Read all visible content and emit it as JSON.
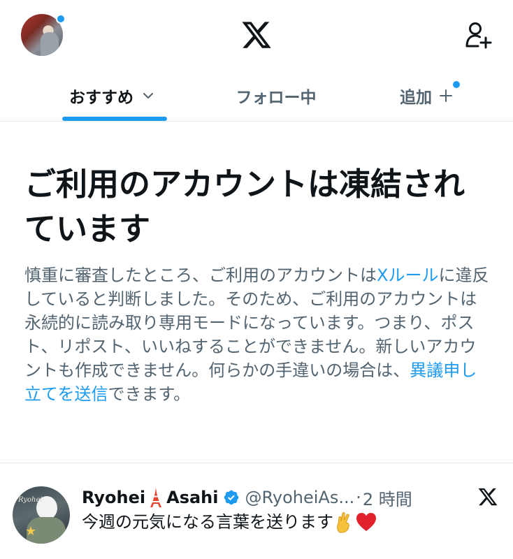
{
  "header": {
    "avatar_icon": "profile-avatar",
    "logo_icon": "x-logo-icon",
    "add_user_icon": "add-user-icon"
  },
  "tabs": [
    {
      "label": "おすすめ",
      "active": true,
      "icon": "chevron-down-icon"
    },
    {
      "label": "フォロー中",
      "active": false
    },
    {
      "label": "追加",
      "active": false,
      "icon": "plus-icon"
    }
  ],
  "notice": {
    "title": "ご利用のアカウントは凍結されています",
    "body_parts": [
      "慎重に審査したところ、ご利用のアカウントは",
      "Xルール",
      "に違反していると判断しました。そのため、ご利用のアカウントは永続的に読み取り専用モードになっています。つまり、ポスト、リポスト、いいねすることができません。新しいアカウントも作成できません。何らかの手違いの場合は、",
      "異議申し立てを送信",
      "できます。"
    ]
  },
  "post": {
    "name_first": "Ryohei",
    "name_last": "Asahi",
    "handle": "@RyoheiAs...",
    "separator": "·",
    "time": "2 時間",
    "text": "今週の元気になる言葉を送ります",
    "avatar_script": "Ryohei",
    "avatar_star": "★",
    "icons": [
      "tokyo-tower-emoji",
      "verified-badge-icon",
      "x-logo-icon",
      "crossed-fingers-emoji",
      "red-heart-emoji"
    ]
  },
  "colors": {
    "accent": "#1d9bf0",
    "text_primary": "#0f1419",
    "text_secondary": "#536471",
    "divider": "#e6e9eb"
  }
}
